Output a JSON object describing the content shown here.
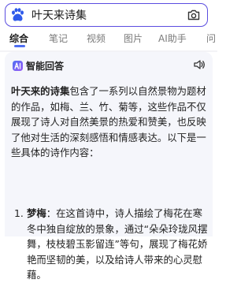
{
  "search": {
    "query": "叶天来诗集"
  },
  "tabs": [
    {
      "label": "综合",
      "active": true
    },
    {
      "label": "笔记",
      "active": false
    },
    {
      "label": "视频",
      "active": false
    },
    {
      "label": "图片",
      "active": false
    },
    {
      "label": "AI助手",
      "active": false
    },
    {
      "label": "问",
      "active": false
    }
  ],
  "ai_answer": {
    "title": "智能回答",
    "intro_bold": "叶天来的诗集",
    "intro_text": "包含了一系列以自然景物为题材的作品，如梅、兰、竹、菊等，这些作品不仅展现了诗人对自然美景的热爱和赞美，也反映了他对生活的深刻感悟和情感表达。以下是一些具体的诗作内容：",
    "items": [
      {
        "number": "1.",
        "bold": "梦梅",
        "text": "：在这首诗中，诗人描绘了梅花在寒冬中独自绽放的景象，通过“朵朵玲珑风摆舞，枝枝碧玉影留连”等句，展现了梅花娇艳而坚韧的美，以及给诗人带来的心灵慰藉。"
      }
    ]
  },
  "colors": {
    "accent": "#4e6ef2",
    "search_border": "#5a4de0",
    "card_bg": "#f5f6fb"
  },
  "icons": {
    "logo": "baidu-paw-icon",
    "camera": "camera-icon",
    "ai_badge": "ai-icon",
    "speaker": "speaker-icon"
  }
}
